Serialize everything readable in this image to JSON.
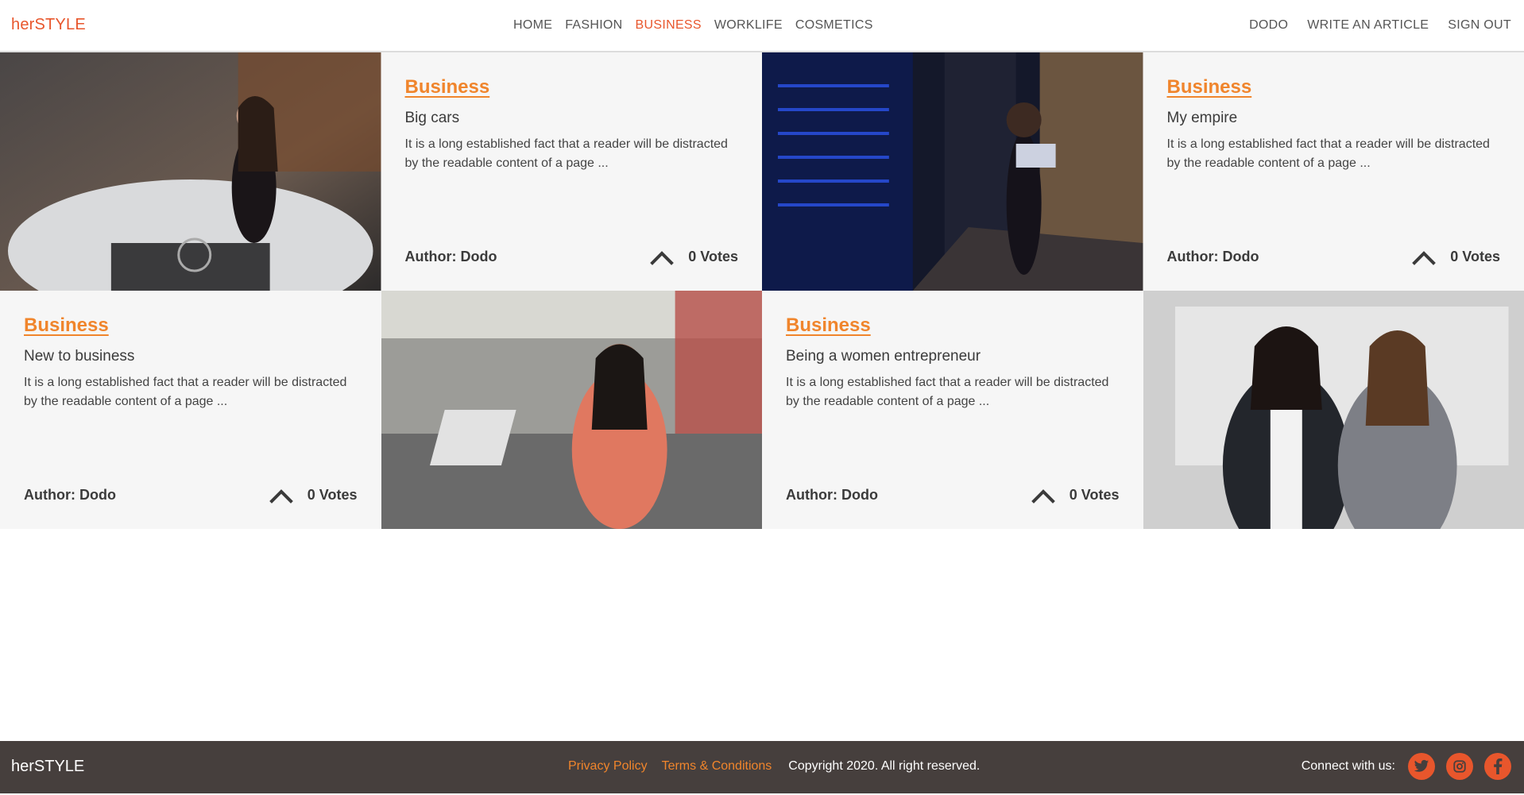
{
  "brand": "herSTYLE",
  "nav": {
    "items": [
      "HOME",
      "FASHION",
      "BUSINESS",
      "WORKLIFE",
      "COSMETICS"
    ],
    "active": "BUSINESS"
  },
  "user_nav": [
    "DODO",
    "WRITE AN ARTICLE",
    "SIGN OUT"
  ],
  "articles": [
    {
      "category": "Business",
      "title": "Big cars",
      "excerpt": "It is a long established fact that a reader will be distracted by the readable content of a page ...",
      "author": "Author: Dodo",
      "votes": "0 Votes",
      "image": "woman-sitting-on-white-car"
    },
    {
      "category": "Business",
      "title": "My empire",
      "excerpt": "It is a long established fact that a reader will be distracted by the readable content of a page ...",
      "author": "Author: Dodo",
      "votes": "0 Votes",
      "image": "woman-with-laptop-in-server-room"
    },
    {
      "category": "Business",
      "title": "New to business",
      "excerpt": "It is a long established fact that a reader will be distracted by the readable content of a page ...",
      "author": "Author: Dodo",
      "votes": "0 Votes",
      "image": "woman-standing-at-desk-in-office"
    },
    {
      "category": "Business",
      "title": "Being a women entrepreneur",
      "excerpt": "It is a long established fact that a reader will be distracted by the readable content of a page ...",
      "author": "Author: Dodo",
      "votes": "0 Votes",
      "image": "two-businesswomen-arms-crossed"
    }
  ],
  "footer": {
    "brand": "herSTYLE",
    "links": [
      "Privacy Policy",
      "Terms & Conditions"
    ],
    "copyright": "Copyright 2020. All right reserved.",
    "connect_label": "Connect with us:",
    "social": [
      "twitter-icon",
      "instagram-icon",
      "facebook-icon"
    ]
  },
  "colors": {
    "accent": "#e8562c",
    "category": "#f0852c",
    "card_bg": "#f6f6f6",
    "footer_bg": "#463f3d"
  }
}
